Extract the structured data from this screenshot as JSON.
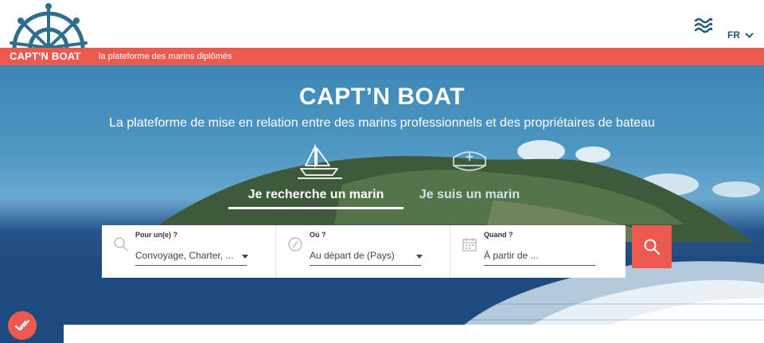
{
  "header": {
    "logo_text": "CAPT'N BOAT",
    "tagline": "la plateforme des marins diplômés",
    "menu_icon": "waves-menu-icon",
    "language": "FR"
  },
  "hero": {
    "title": "CAPT’N BOAT",
    "subtitle": "La plateforme de mise en relation entre des marins professionnels et des propriétaires de bateau",
    "tabs": [
      {
        "label": "Je recherche un marin",
        "icon": "sailboat-icon",
        "active": true
      },
      {
        "label": "Je suis un marin",
        "icon": "captain-hat-icon",
        "active": false
      }
    ]
  },
  "search": {
    "fields": [
      {
        "label": "Pour un(e) ?",
        "value": "Convoyage, Charter, ...",
        "icon": "search-icon"
      },
      {
        "label": "Où ?",
        "value": "Au départ de (Pays)",
        "icon": "compass-icon"
      },
      {
        "label": "Quand ?",
        "placeholder": "À partir de ...",
        "icon": "calendar-icon"
      }
    ],
    "button_icon": "search-icon"
  },
  "colors": {
    "accent": "#ec5a4f",
    "brand_blue": "#1e5a78",
    "white": "#ffffff"
  }
}
